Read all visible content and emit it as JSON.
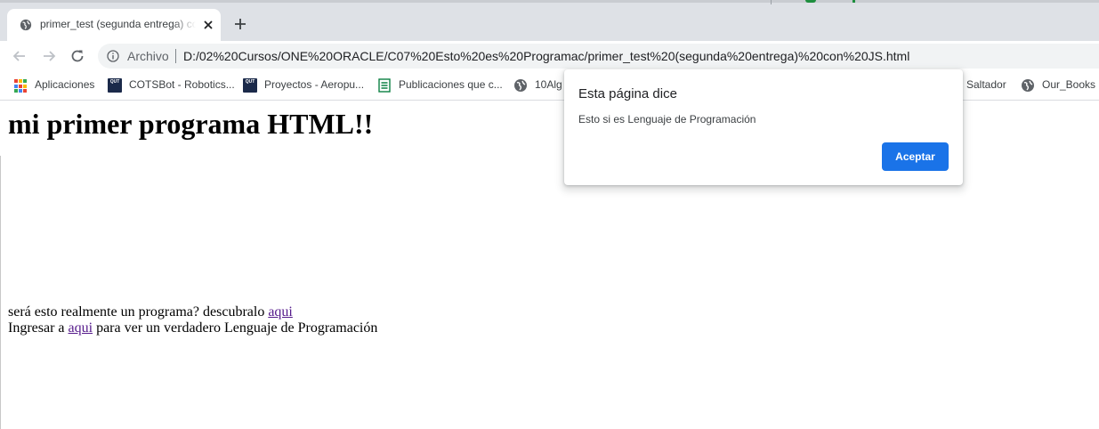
{
  "browser": {
    "tab_title": "primer_test (segunda entrega) con JS",
    "url_scheme_label": "Archivo",
    "url": "D:/02%20Cursos/ONE%20ORACLE/C07%20Esto%20es%20Programac/primer_test%20(segunda%20entrega)%20con%20JS.html"
  },
  "bookmarks": [
    {
      "label": "Aplicaciones",
      "icon": "apps-grid-icon"
    },
    {
      "label": "COTSBot - Robotics...",
      "icon": "qut-icon"
    },
    {
      "label": "Proyectos - Aeropu...",
      "icon": "qut-icon"
    },
    {
      "label": "Publicaciones que c...",
      "icon": "document-icon"
    },
    {
      "label": "10Alg",
      "icon": "globe-icon"
    },
    {
      "label": "Saltador",
      "icon": "none"
    },
    {
      "label": "Our_Books",
      "icon": "globe-icon"
    }
  ],
  "page": {
    "heading": "mi primer programa HTML!!",
    "line1_text": "será esto realmente un programa? descubralo ",
    "line1_link": "aqui",
    "line2_before": "Ingresar a ",
    "line2_link": "aqui",
    "line2_after": " para ver un verdadero Lenguaje de Programación"
  },
  "dialog": {
    "title": "Esta página dice",
    "message": "Esto si es Lenguaje de Programación",
    "ok_label": "Aceptar"
  },
  "colors": {
    "accent": "#1a73e8",
    "visited_link": "#551a8b",
    "tabstrip_bg": "#dee1e6",
    "omnibox_bg": "#f1f3f4"
  }
}
